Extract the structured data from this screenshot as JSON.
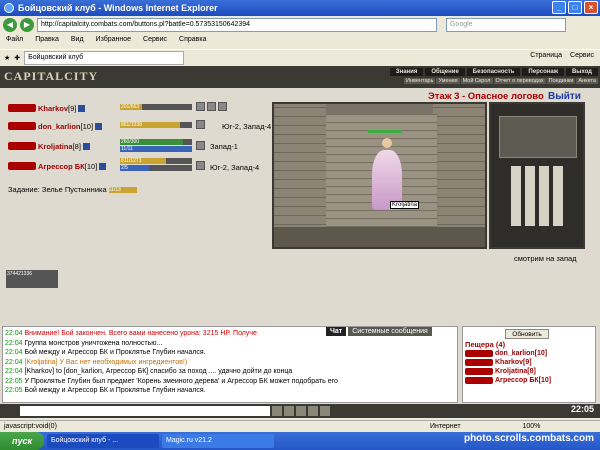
{
  "window": {
    "title": "Бойцовский клуб - Windows Internet Explorer"
  },
  "browser": {
    "address": "http://capitalcity.combats.com/buttons.pl?battle=0.57353150642394",
    "search_placeholder": "Google",
    "menu": [
      "Файл",
      "Правка",
      "Вид",
      "Избранное",
      "Сервис",
      "Справка"
    ],
    "tab": "Бойцовский клуб",
    "toolbar_right": [
      "Страница",
      "Сервис"
    ]
  },
  "game": {
    "logo": "CAPITALCITY",
    "menu_top": [
      "Знания",
      "Общение",
      "Безопасность",
      "Персонаж",
      "Выход"
    ],
    "menu_sub": [
      "Инвентарь",
      "Умения",
      "Мой Скрол",
      "Отчет о переводах",
      "Поединки",
      "Анкета"
    ],
    "characters": [
      {
        "name": "Kharkov",
        "level": "[9]",
        "hp": "201/663",
        "hp_pct": 30
      },
      {
        "name": "don_karlion",
        "level": "[10]",
        "hp": "861/1038",
        "hp_pct": 83,
        "location": "Юг-2, Запад-4"
      },
      {
        "name": "Kroljatina",
        "level": "[8]",
        "hp": "260/300",
        "mana": "11/11",
        "hp_pct": 87,
        "location": "Запад-1"
      },
      {
        "name": "Агрессор БК",
        "level": "[10]",
        "hp": "811/1273",
        "mana": "2/5",
        "hp_pct": 64,
        "location": "Юг-2, Запад-4"
      }
    ],
    "task_label": "Задание: Зелье Пустынника",
    "task_progress": "11/13",
    "counter": "374421336",
    "scene_title": "Этаж 3 - Опасное логово",
    "exit_label": "Выйти",
    "npc_label": "Kroljatina",
    "map_caption": "смотрим на запад",
    "chat_tabs": [
      "Чат",
      "Системные сообщения"
    ],
    "chat_lines": [
      {
        "time": "22:04",
        "text": "Внимание! Бой закончен. Всего вами нанесено урона: 3215 HP. Получе"
      },
      {
        "time": "22:04",
        "text": "Группа монстров уничтожена полностью..."
      },
      {
        "time": "22:04",
        "text": "Бой между и Агрессор БК и Проклятье Глубин начался."
      },
      {
        "time": "22:04",
        "text": "[Kroljatina] У Вас нет необходимых ингредиентов!)"
      },
      {
        "time": "22:04",
        "text": "[Kharkov] to [don_karlion, Агрессор БК] спасибо за поход .... удачно дойти до конца"
      },
      {
        "time": "22:05",
        "text": "У Проклятье Глубин был предмет 'Корень змеиного дерева' и Агрессор БК может подобрать его"
      },
      {
        "time": "22:05",
        "text": "Бой между и Агрессор БК и Проклятье Глубин начался."
      }
    ],
    "refresh_label": "Обновить",
    "cave_title": "Пещера (4)",
    "cave_members": [
      "don_karlion[10]",
      "Kharkov[9]",
      "Kroljatina[8]",
      "Агрессор БК[10]"
    ],
    "clock": "22:05"
  },
  "status": {
    "left": "javascript:void(0)",
    "zone": "Интернет",
    "zoom": "100%"
  },
  "taskbar": {
    "start": "пуск",
    "items": [
      "Бойцовский клуб - ...",
      "Magic.ru v21.2"
    ]
  },
  "watermark": "photo.scrolls.combats.com"
}
